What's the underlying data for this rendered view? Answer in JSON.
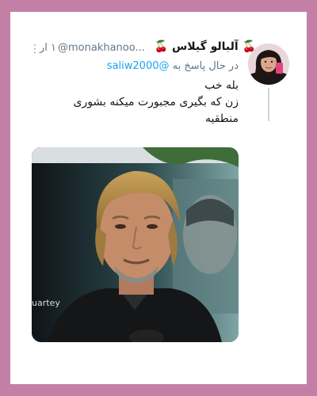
{
  "tweet": {
    "display_name": "آلبالو گیلاس",
    "name_emoji": "🍒",
    "handle": "@monakhanoo...",
    "timestamp": "۱۰ ار",
    "more_icon": "more-dots-icon",
    "reply_prefix": "در حال پاسخ به",
    "reply_handle": "@saliw2000",
    "text_lines": [
      "بله خب",
      "زن که بگیری مجبورت میکنه بشوری",
      "منطقیه"
    ],
    "media_caption": "uartey"
  },
  "colors": {
    "frame": "#c47fa6",
    "link": "#1da1f2",
    "secondary_text": "#657786"
  }
}
